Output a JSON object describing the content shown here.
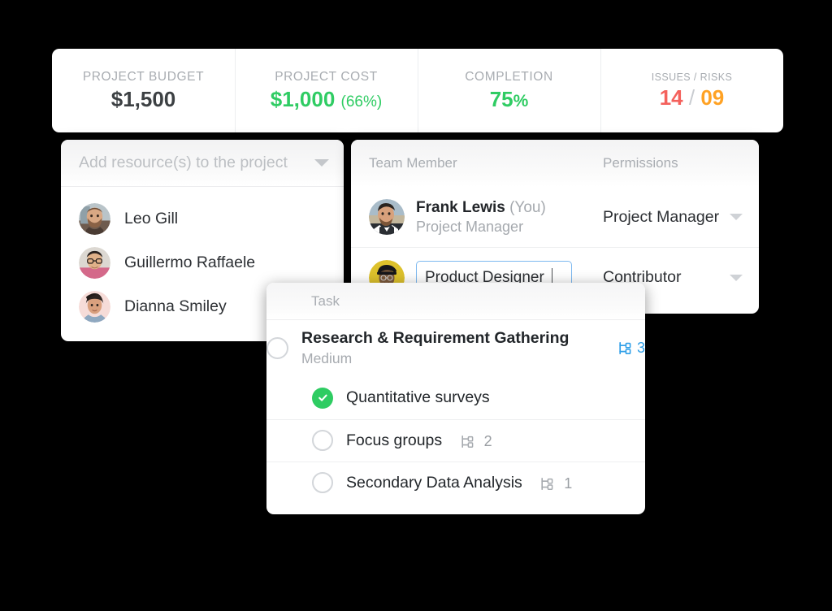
{
  "stats": {
    "cells": [
      {
        "label": "PROJECT BUDGET",
        "value": "$1,500"
      },
      {
        "label": "PROJECT COST",
        "value": "$1,000",
        "suffix": "(66%)"
      },
      {
        "label": "COMPLETION",
        "value": "75",
        "unit": "%"
      },
      {
        "label": "ISSUES / RISKS",
        "issues": "14",
        "slash": "/",
        "risks": "09"
      }
    ]
  },
  "resources": {
    "placeholder": "Add resource(s) to the project",
    "dropdown_icon": "chevron-down-icon",
    "people": [
      {
        "name": "Leo Gill"
      },
      {
        "name": "Guillermo Raffaele"
      },
      {
        "name": "Dianna Smiley"
      }
    ]
  },
  "team": {
    "columns": {
      "member": "Team Member",
      "permissions": "Permissions"
    },
    "rows": [
      {
        "name": "Frank Lewis",
        "you": "(You)",
        "role": "Project Manager",
        "permission": "Project Manager",
        "editing": false
      },
      {
        "role_input_value": "Product Designer",
        "permission": "Contributor",
        "editing": true
      }
    ]
  },
  "tasks": {
    "column_label": "Task",
    "items": [
      {
        "title": "Research & Requirement Gathering",
        "priority": "Medium",
        "checked": false,
        "subtasks": "3",
        "subtask_highlight": true,
        "level": 0
      },
      {
        "title": "Quantitative surveys",
        "checked": true,
        "subtasks": "",
        "level": 1
      },
      {
        "title": "Focus groups",
        "checked": false,
        "subtasks": "2",
        "level": 1
      },
      {
        "title": "Secondary Data Analysis",
        "checked": false,
        "subtasks": "1",
        "level": 1
      }
    ]
  },
  "colors": {
    "green": "#2ecc62",
    "red": "#f4615c",
    "orange": "#ffa224",
    "blue": "#2f9fe8",
    "focus_border": "#7db9f0"
  }
}
